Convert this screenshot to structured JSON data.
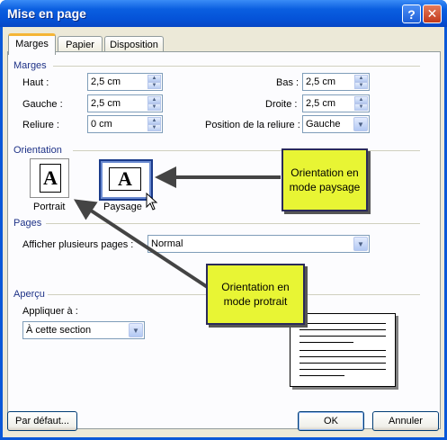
{
  "window": {
    "title": "Mise en page"
  },
  "tabs": [
    {
      "label": "Marges"
    },
    {
      "label": "Papier"
    },
    {
      "label": "Disposition"
    }
  ],
  "marges": {
    "group_label": "Marges",
    "haut": {
      "label": "Haut :",
      "value": "2,5 cm"
    },
    "gauche": {
      "label": "Gauche :",
      "value": "2,5 cm"
    },
    "reliure": {
      "label": "Reliure :",
      "value": "0 cm"
    },
    "bas": {
      "label": "Bas :",
      "value": "2,5 cm"
    },
    "droite": {
      "label": "Droite :",
      "value": "2,5 cm"
    },
    "position_reliure": {
      "label": "Position de la reliure :",
      "value": "Gauche"
    }
  },
  "orientation": {
    "group_label": "Orientation",
    "portrait_label": "Portrait",
    "paysage_label": "Paysage",
    "icon_letter": "A"
  },
  "pages": {
    "group_label": "Pages",
    "label": "Afficher plusieurs pages :",
    "value": "Normal"
  },
  "apercu": {
    "group_label": "Aperçu",
    "label": "Appliquer à :",
    "value": "À cette section"
  },
  "callouts": {
    "paysage": "Orientation en mode paysage",
    "portrait": "Orientation en mode protrait"
  },
  "buttons": {
    "default": "Par défaut...",
    "ok": "OK",
    "cancel": "Annuler"
  },
  "colors": {
    "titlebar": "#0a5ee0",
    "callout_bg": "#e8f534",
    "group_label": "#1e3287"
  }
}
